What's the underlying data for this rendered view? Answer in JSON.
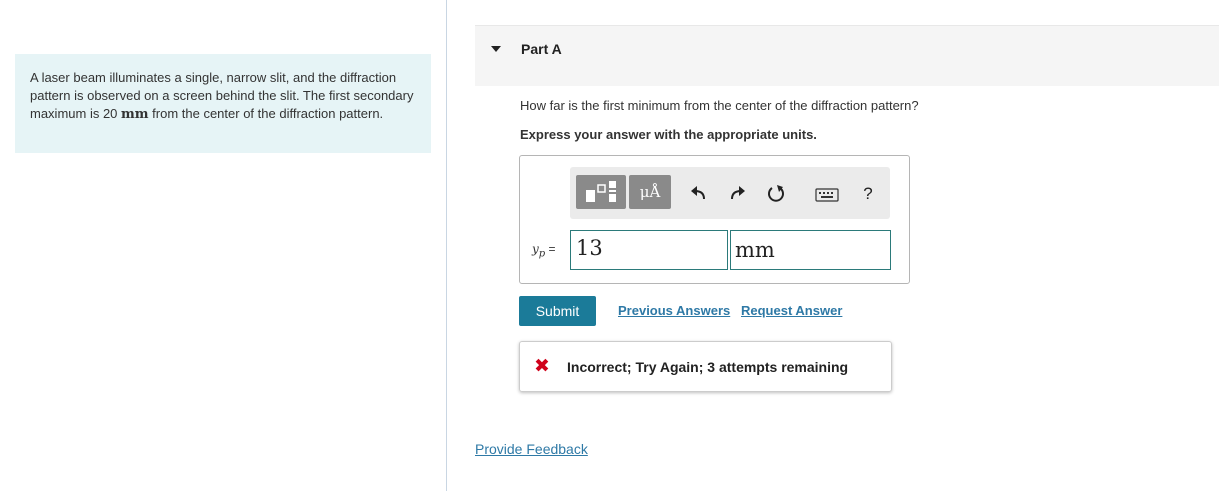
{
  "problem": {
    "text_before": "A laser beam illuminates a single, narrow slit, and the diffraction pattern is observed on a screen behind the slit. The first secondary maximum is 20 ",
    "unit": "mm",
    "text_after": " from the center of the diffraction pattern."
  },
  "part": {
    "title": "Part A"
  },
  "question": "How far is the first minimum from the center of the diffraction pattern?",
  "instruction": "Express your answer with the appropriate units.",
  "toolbar": {
    "units_label": "μÅ",
    "undo_icon": "undo-icon",
    "redo_icon": "redo-icon",
    "reset_icon": "reset-icon",
    "keyboard_icon": "keyboard-icon",
    "help_label": "?"
  },
  "answer": {
    "var_symbol": "y",
    "var_subscript": "p",
    "equals": " =",
    "value": "13",
    "unit": "mm"
  },
  "buttons": {
    "submit": "Submit",
    "previous_answers": "Previous Answers",
    "request_answer": "Request Answer"
  },
  "feedback": {
    "icon": "incorrect-x-icon",
    "text": "Incorrect; Try Again; 3 attempts remaining"
  },
  "provide_feedback": "Provide Feedback",
  "colors": {
    "problem_bg": "#e6f4f6",
    "submit_bg": "#1b7b99",
    "link": "#2e79a6",
    "error": "#d0021b"
  }
}
